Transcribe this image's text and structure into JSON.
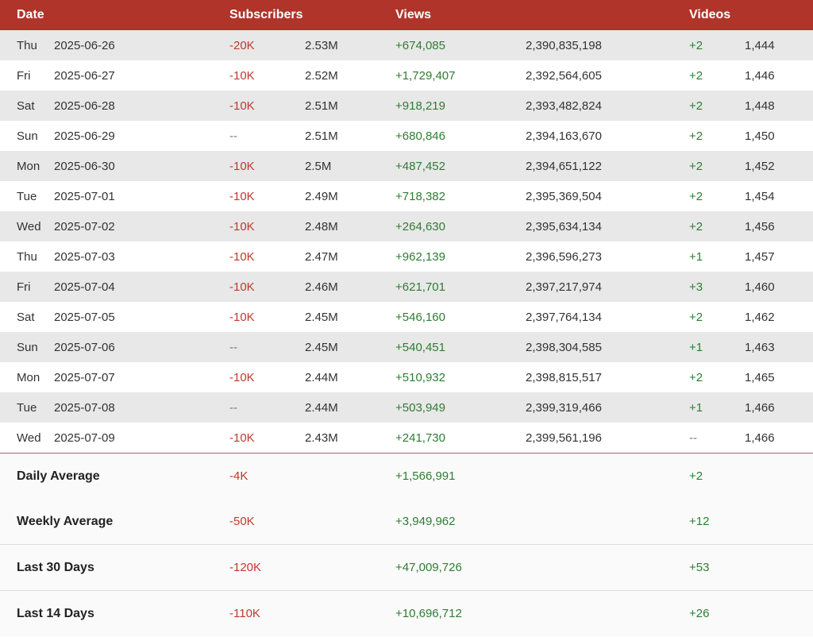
{
  "header": {
    "date": "Date",
    "subscribers": "Subscribers",
    "views": "Views",
    "videos": "Videos"
  },
  "rows": [
    {
      "day": "Thu",
      "date": "2025-06-26",
      "sub_delta": "-20K",
      "sub_total": "2.53M",
      "view_delta": "+674,085",
      "view_total": "2,390,835,198",
      "video_delta": "+2",
      "video_total": "1,444"
    },
    {
      "day": "Fri",
      "date": "2025-06-27",
      "sub_delta": "-10K",
      "sub_total": "2.52M",
      "view_delta": "+1,729,407",
      "view_total": "2,392,564,605",
      "video_delta": "+2",
      "video_total": "1,446"
    },
    {
      "day": "Sat",
      "date": "2025-06-28",
      "sub_delta": "-10K",
      "sub_total": "2.51M",
      "view_delta": "+918,219",
      "view_total": "2,393,482,824",
      "video_delta": "+2",
      "video_total": "1,448"
    },
    {
      "day": "Sun",
      "date": "2025-06-29",
      "sub_delta": "--",
      "sub_total": "2.51M",
      "view_delta": "+680,846",
      "view_total": "2,394,163,670",
      "video_delta": "+2",
      "video_total": "1,450"
    },
    {
      "day": "Mon",
      "date": "2025-06-30",
      "sub_delta": "-10K",
      "sub_total": "2.5M",
      "view_delta": "+487,452",
      "view_total": "2,394,651,122",
      "video_delta": "+2",
      "video_total": "1,452"
    },
    {
      "day": "Tue",
      "date": "2025-07-01",
      "sub_delta": "-10K",
      "sub_total": "2.49M",
      "view_delta": "+718,382",
      "view_total": "2,395,369,504",
      "video_delta": "+2",
      "video_total": "1,454"
    },
    {
      "day": "Wed",
      "date": "2025-07-02",
      "sub_delta": "-10K",
      "sub_total": "2.48M",
      "view_delta": "+264,630",
      "view_total": "2,395,634,134",
      "video_delta": "+2",
      "video_total": "1,456"
    },
    {
      "day": "Thu",
      "date": "2025-07-03",
      "sub_delta": "-10K",
      "sub_total": "2.47M",
      "view_delta": "+962,139",
      "view_total": "2,396,596,273",
      "video_delta": "+1",
      "video_total": "1,457"
    },
    {
      "day": "Fri",
      "date": "2025-07-04",
      "sub_delta": "-10K",
      "sub_total": "2.46M",
      "view_delta": "+621,701",
      "view_total": "2,397,217,974",
      "video_delta": "+3",
      "video_total": "1,460"
    },
    {
      "day": "Sat",
      "date": "2025-07-05",
      "sub_delta": "-10K",
      "sub_total": "2.45M",
      "view_delta": "+546,160",
      "view_total": "2,397,764,134",
      "video_delta": "+2",
      "video_total": "1,462"
    },
    {
      "day": "Sun",
      "date": "2025-07-06",
      "sub_delta": "--",
      "sub_total": "2.45M",
      "view_delta": "+540,451",
      "view_total": "2,398,304,585",
      "video_delta": "+1",
      "video_total": "1,463"
    },
    {
      "day": "Mon",
      "date": "2025-07-07",
      "sub_delta": "-10K",
      "sub_total": "2.44M",
      "view_delta": "+510,932",
      "view_total": "2,398,815,517",
      "video_delta": "+2",
      "video_total": "1,465"
    },
    {
      "day": "Tue",
      "date": "2025-07-08",
      "sub_delta": "--",
      "sub_total": "2.44M",
      "view_delta": "+503,949",
      "view_total": "2,399,319,466",
      "video_delta": "+1",
      "video_total": "1,466"
    },
    {
      "day": "Wed",
      "date": "2025-07-09",
      "sub_delta": "-10K",
      "sub_total": "2.43M",
      "view_delta": "+241,730",
      "view_total": "2,399,561,196",
      "video_delta": "--",
      "video_total": "1,466"
    }
  ],
  "summary": [
    {
      "label": "Daily Average",
      "subscribers": "-4K",
      "views": "+1,566,991",
      "videos": "+2"
    },
    {
      "label": "Weekly Average",
      "subscribers": "-50K",
      "views": "+3,949,962",
      "videos": "+12"
    },
    {
      "label": "Last 30 Days",
      "subscribers": "-120K",
      "views": "+47,009,726",
      "videos": "+53"
    },
    {
      "label": "Last 14 Days",
      "subscribers": "-110K",
      "views": "+10,696,712",
      "videos": "+26"
    }
  ],
  "colors": {
    "header_bg": "#b0342a",
    "negative": "#c0392b",
    "positive": "#2e7d32",
    "stripe": "#e8e8e8"
  }
}
